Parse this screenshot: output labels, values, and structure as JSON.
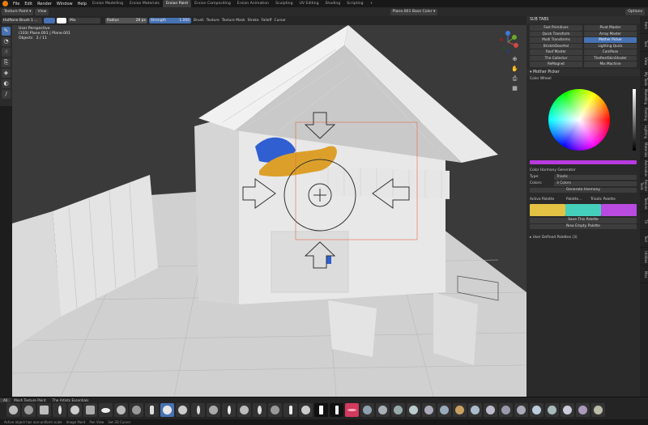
{
  "menu": [
    "File",
    "Edit",
    "Render",
    "Window",
    "Help"
  ],
  "workspaces": [
    {
      "label": "Erxion Modelling",
      "active": false
    },
    {
      "label": "Erxion Materials",
      "active": false
    },
    {
      "label": "Erxion Paint",
      "active": true
    },
    {
      "label": "Erxion Compositing",
      "active": false
    },
    {
      "label": "Erxion Animation",
      "active": false
    },
    {
      "label": "Sculpting",
      "active": false
    },
    {
      "label": "UV Editing",
      "active": false
    },
    {
      "label": "Shading",
      "active": false
    },
    {
      "label": "Scripting",
      "active": false
    }
  ],
  "header": {
    "mode": "Texture Paint",
    "view": "View",
    "image": "Plane.001 Base Color",
    "options": "Options"
  },
  "toolsettings": {
    "brush": "Halftone Brush 1 ...",
    "blend": "Mix",
    "radius_label": "Radius",
    "radius_value": "28 px",
    "strength_label": "Strength",
    "strength_value": "1.000",
    "menus": [
      "Brush",
      "Texture",
      "Texture Mask",
      "Stroke",
      "Falloff",
      "Cursor"
    ]
  },
  "viewport": {
    "perspective": "User Perspective",
    "object": "(103) Plane.001 | Plane.001",
    "objects_label": "Objects",
    "objects_value": "2 / 11"
  },
  "panel": {
    "subtabs_title": "SUB TABS",
    "subtabs": [
      {
        "label": "Fast Primitives",
        "active": false
      },
      {
        "label": "Pivot Master",
        "active": false
      },
      {
        "label": "Quick Transform",
        "active": false
      },
      {
        "label": "Array Master",
        "active": false
      },
      {
        "label": "Multi Transforms",
        "active": false
      },
      {
        "label": "Mother Picker",
        "active": true
      },
      {
        "label": "BrickInDoorHol",
        "active": false
      },
      {
        "label": "Lighting Quick",
        "active": false
      },
      {
        "label": "Roof Master",
        "active": false
      },
      {
        "label": "CamPose",
        "active": false
      },
      {
        "label": "The Collector",
        "active": false
      },
      {
        "label": "TheRestSkinShader",
        "active": false
      },
      {
        "label": "ReMagnet",
        "active": false
      },
      {
        "label": "Mix Machine",
        "active": false
      }
    ],
    "picker_title": "Mother Picker",
    "wheel_title": "Color Wheel",
    "current_color": "#b73bde",
    "harmony_title": "Color Harmony Generator",
    "type_label": "Type:",
    "type_value": "Triadic",
    "colors_label": "Colors:",
    "colors_value": "3 Colors",
    "generate": "Generate Harmony",
    "active_palette": "Active Palette",
    "palette_name": "Palette...",
    "palette_preset": "Triadic Palette",
    "swatches": [
      "#e3c244",
      "#45d0bc",
      "#b94be0"
    ],
    "save": "Save This Palette",
    "new_palette": "New Empty Palette",
    "user_palettes": "User Defined Palettes (3)"
  },
  "vtabs": [
    "Item",
    "Tool",
    "View",
    "My Tools",
    "Modelling",
    "Painting",
    "Lighting",
    "Materials",
    "Animation",
    "Render Tools",
    "Texture",
    "TX",
    "Text",
    "Utilities",
    "Misc"
  ],
  "shelf": {
    "tabs": [
      "All",
      "Mesh Texture Paint",
      "The Artists Essentials"
    ]
  },
  "status": [
    "Active object has non-uniform scale",
    "Image Paint",
    "Pan View",
    "Set 3D Cursor"
  ]
}
